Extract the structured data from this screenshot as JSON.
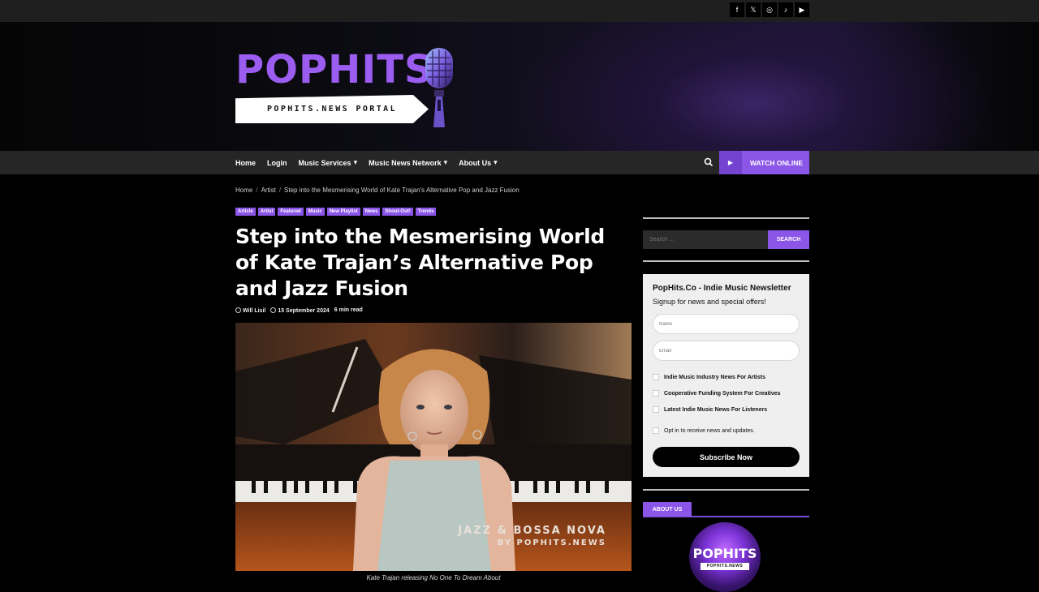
{
  "social": {
    "items": [
      {
        "name": "facebook",
        "glyph": "f"
      },
      {
        "name": "x",
        "glyph": "𝕏"
      },
      {
        "name": "instagram",
        "glyph": "◎"
      },
      {
        "name": "tiktok",
        "glyph": "♪"
      },
      {
        "name": "youtube",
        "glyph": "▶"
      }
    ]
  },
  "brand": {
    "logo_text": "POPHITS",
    "tagline": "POPHITS.NEWS PORTAL"
  },
  "nav": {
    "items": [
      {
        "label": "Home",
        "dropdown": false
      },
      {
        "label": "Login",
        "dropdown": false
      },
      {
        "label": "Music Services",
        "dropdown": true
      },
      {
        "label": "Music News Network",
        "dropdown": true
      },
      {
        "label": "About Us",
        "dropdown": true
      }
    ],
    "watch_label": "WATCH ONLINE"
  },
  "breadcrumb": [
    "Home",
    "Artist",
    "Step into the Mesmerising World of Kate Trajan’s Alternative Pop and Jazz Fusion"
  ],
  "tags": [
    "Article",
    "Artist",
    "Featured",
    "Music",
    "New Playlist",
    "News",
    "Shout-Out!",
    "Trends"
  ],
  "article": {
    "title": "Step into the Mesmerising World of Kate Trajan’s Alternative Pop and Jazz Fusion",
    "author": "Will Lisil",
    "date": "15 September 2024",
    "read_time": "6 min read",
    "image_overlay_line1": "JAZZ & BOSSA NOVA",
    "image_overlay_line2": "BY POPHITS.NEWS",
    "caption": "Kate Trajan releasing No One To Dream About"
  },
  "sidebar": {
    "search_placeholder": "Search ...",
    "search_button": "SEARCH",
    "newsletter": {
      "title": "PopHits.Co - Indie Music Newsletter",
      "subtitle": "Signup for news and special offers!",
      "name_placeholder": "Name",
      "email_placeholder": "Email",
      "options": [
        "Indie Music Industry News For Artists",
        "Cooperative Funding System For Creatives",
        "Latest Indie Music News For Listeners"
      ],
      "opt_in": "Opt in to receive news and updates.",
      "button": "Subscribe Now"
    },
    "about_label": "ABOUT US",
    "about_logo_text": "POPHITS",
    "about_logo_sub": "POPHITS.NEWS"
  },
  "colors": {
    "accent": "#8b55e8",
    "background": "#000000",
    "nav_bg": "#262626"
  }
}
